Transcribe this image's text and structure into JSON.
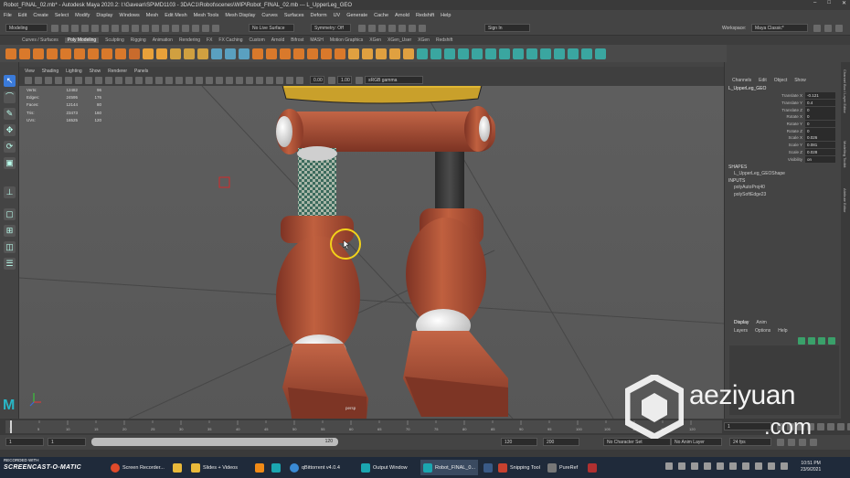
{
  "window": {
    "title": "Robot_FINAL_02.mb* - Autodesk Maya 2020.2: I:\\Gavean\\SP\\MD1103 - 3DAC1\\Robot\\scenes\\WIP\\Robot_FINAL_02.mb --- L_UpperLeg_GEO"
  },
  "menubar": [
    "File",
    "Edit",
    "Create",
    "Select",
    "Modify",
    "Display",
    "Windows",
    "Mesh",
    "Edit Mesh",
    "Mesh Tools",
    "Mesh Display",
    "Curves",
    "Surfaces",
    "Deform",
    "UV",
    "Generate",
    "Cache",
    "Arnold",
    "Redshift",
    "Help"
  ],
  "statusline": {
    "menuset": "Modeling",
    "live_surface": "No Live Surface",
    "symmetry": "Symmetry: Off",
    "sign_in": "Sign In",
    "workspace_label": "Workspace:",
    "workspace": "Maya Classic*"
  },
  "shelf_tabs": [
    "Curves / Surfaces",
    "Poly Modeling",
    "Sculpting",
    "Rigging",
    "Animation",
    "Rendering",
    "FX",
    "FX Caching",
    "Custom",
    "Arnold",
    "Bifrost",
    "MASH",
    "Motion Graphics",
    "XGen",
    "XGen_User",
    "XGen",
    "Redshift"
  ],
  "shelf_active_tab": "Poly Modeling",
  "panel": {
    "menu": [
      "View",
      "Shading",
      "Lighting",
      "Show",
      "Renderer",
      "Panels"
    ],
    "exposure": "0.00",
    "gamma": "1.00",
    "color_space": "sRGB gamma",
    "camera_label": "persp"
  },
  "hud": [
    {
      "label": "Verts:",
      "value": "12482",
      "sel": "96"
    },
    {
      "label": "Edges:",
      "value": "24595",
      "sel": "176"
    },
    {
      "label": "Faces:",
      "value": "12144",
      "sel": "80"
    },
    {
      "label": "Tris:",
      "value": "23473",
      "sel": "160"
    },
    {
      "label": "UVs:",
      "value": "16525",
      "sel": "120"
    }
  ],
  "channel_box": {
    "menu": [
      "Channels",
      "Edit",
      "Object",
      "Show"
    ],
    "object": "L_UpperLeg_GEO",
    "attributes": [
      {
        "name": "Translate X",
        "value": "-0.121"
      },
      {
        "name": "Translate Y",
        "value": "0.4"
      },
      {
        "name": "Translate Z",
        "value": "0"
      },
      {
        "name": "Rotate X",
        "value": "0"
      },
      {
        "name": "Rotate Y",
        "value": "0"
      },
      {
        "name": "Rotate Z",
        "value": "0"
      },
      {
        "name": "Scale X",
        "value": "0.026"
      },
      {
        "name": "Scale Y",
        "value": "0.081"
      },
      {
        "name": "Scale Z",
        "value": "0.028"
      },
      {
        "name": "Visibility",
        "value": "on"
      }
    ],
    "shapes_header": "SHAPES",
    "shape": "L_UpperLeg_GEOShape",
    "inputs_header": "INPUTS",
    "inputs": [
      "polyAutoProj40",
      "polySoftEdge23"
    ]
  },
  "layer_editor": {
    "tabs": [
      "Display",
      "Anim"
    ],
    "menu": [
      "Layers",
      "Options",
      "Help"
    ]
  },
  "side_tabs": [
    "Channel Box / Layer Editor",
    "Modelling Toolkit",
    "Attribute Editor"
  ],
  "timeslider": {
    "current_frame": "1",
    "tick_labels": [
      "1",
      "5",
      "10",
      "15",
      "20",
      "25",
      "30",
      "35",
      "40",
      "45",
      "50",
      "55",
      "60",
      "65",
      "70",
      "75",
      "80",
      "85",
      "90",
      "95",
      "100",
      "105",
      "110",
      "115",
      "120"
    ]
  },
  "rangeslider": {
    "start": "1",
    "playback_start": "1",
    "slider_end": "120",
    "playback_end": "120",
    "anim_end": "200",
    "character_set": "No Character Set",
    "anim_layer": "No Anim Layer",
    "fps": "24 fps"
  },
  "taskbar": {
    "items": [
      "Screen Recorder...",
      "Slides + Videos",
      "qBittorrent v4.0.4",
      "Output Window",
      "Robot_FINAL_0...",
      "Snipping Tool",
      "PureRef"
    ],
    "active": "Robot_FINAL_0...",
    "time": "10:51 PM",
    "date": "23/9/2021"
  },
  "watermark": {
    "recorded_with": "RECORDED WITH",
    "brand": "SCREENCAST-O-MATIC"
  },
  "overlay_logo": {
    "name": "aeziyuan",
    "domain": ".com"
  },
  "colors": {
    "accent": "#3a7ad9",
    "robot_orange": "#b5553a",
    "viewport_bg": "#5d5d5d"
  }
}
